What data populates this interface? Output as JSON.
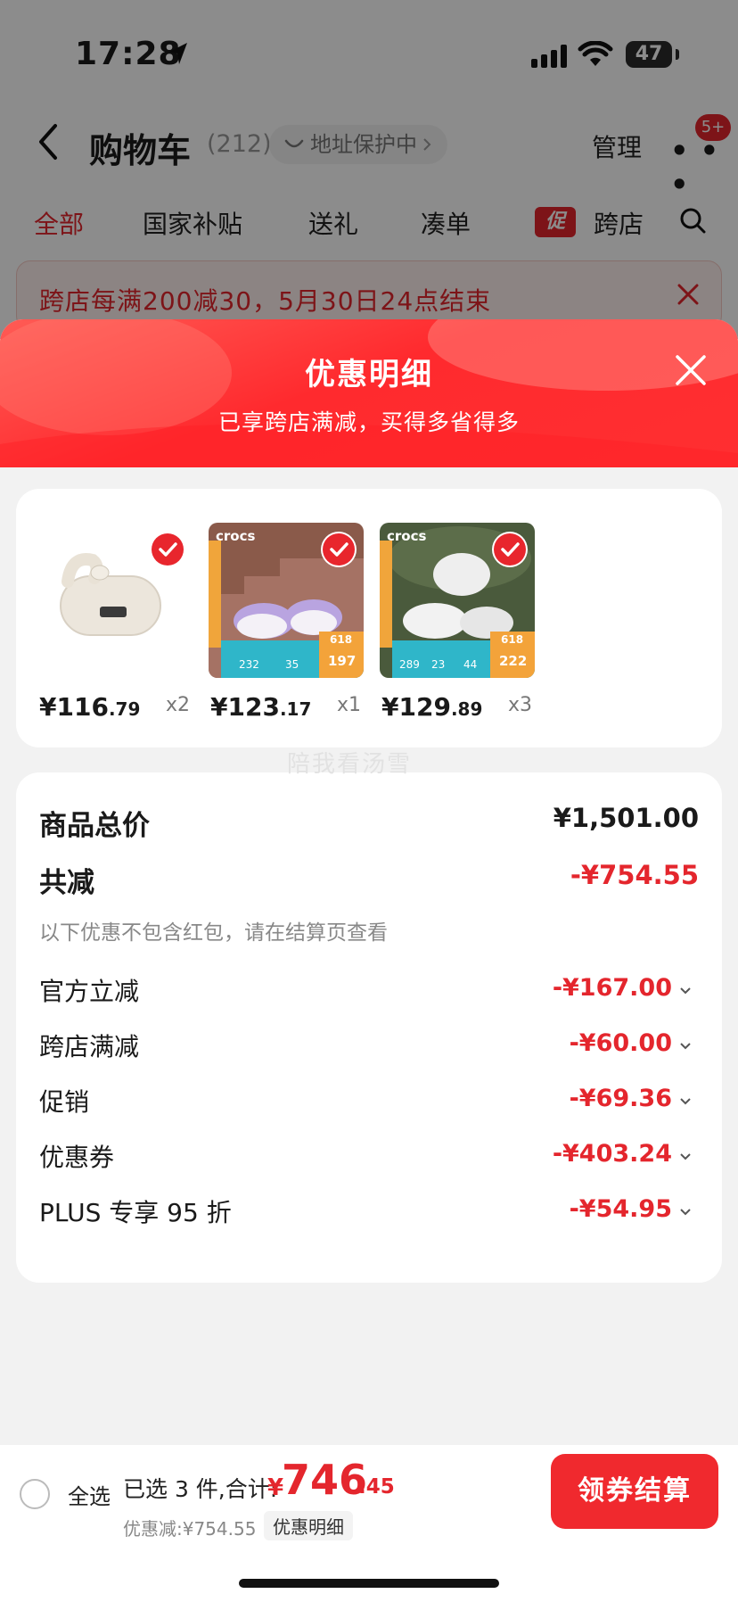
{
  "status_bar": {
    "time": "17:28",
    "battery": "47"
  },
  "nav": {
    "title": "购物车",
    "count": "(212)",
    "address_protection": "地址保护中",
    "manage": "管理",
    "more_badge": "5+"
  },
  "tabs": [
    "全部",
    "国家补贴",
    "送礼",
    "凑单",
    "跨店"
  ],
  "promo_tag": "促",
  "promo_banner": "跨店每满200减30，5月30日24点结束",
  "sheet": {
    "title": "优惠明细",
    "subtitle": "已享跨店满减，买得多省得多"
  },
  "products": [
    {
      "price_int": "¥116",
      "price_dec": ".79",
      "qty": "x2",
      "image": "earbuds"
    },
    {
      "price_int": "¥123",
      "price_dec": ".17",
      "qty": "x1",
      "image": "crocs-purple",
      "brand": "crocs",
      "tag": "618",
      "price_tag": "197",
      "nums": [
        "232",
        "35"
      ]
    },
    {
      "price_int": "¥129",
      "price_dec": ".89",
      "qty": "x3",
      "image": "crocs-white",
      "brand": "crocs",
      "tag": "618",
      "price_tag": "222",
      "nums": [
        "289",
        "23",
        "44"
      ]
    }
  ],
  "watermark": "陪我看汤雪",
  "summary": {
    "total_label": "商品总价",
    "total_value": "¥1,501.00",
    "reduce_label": "共减",
    "reduce_value": "-¥754.55",
    "note": "以下优惠不包含红包，请在结算页查看",
    "items": [
      {
        "label": "官方立减",
        "value": "-¥167.00"
      },
      {
        "label": "跨店满减",
        "value": "-¥60.00"
      },
      {
        "label": "促销",
        "value": "-¥69.36"
      },
      {
        "label": "优惠券",
        "value": "-¥403.24"
      },
      {
        "label": "PLUS 专享 95 折",
        "value": "-¥54.95"
      }
    ]
  },
  "bottom": {
    "select_all": "全选",
    "selected": "已选 3 件,合计:",
    "total_yen": "¥",
    "total_int": "746",
    "total_dec": ".45",
    "discount": "优惠减:¥754.55",
    "detail": "优惠明细",
    "checkout": "领券结算"
  },
  "colors": {
    "accent": "#e4262d",
    "header_red": "#ff2a2e"
  }
}
